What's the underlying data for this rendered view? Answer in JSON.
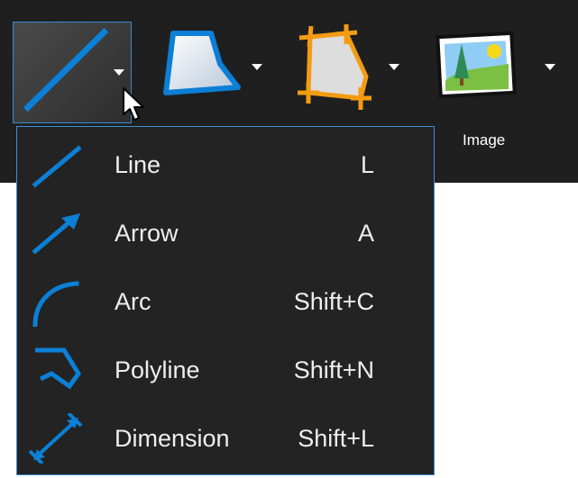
{
  "toolbar": {
    "tools": [
      {
        "name": "line-tool",
        "icon": "line-icon",
        "dropdown": true
      },
      {
        "name": "polygon-tool",
        "icon": "polygon-icon",
        "dropdown": true
      },
      {
        "name": "crop-tool",
        "icon": "crop-icon",
        "dropdown": true
      },
      {
        "name": "image-tool",
        "icon": "image-icon",
        "dropdown": true,
        "label": "Image"
      }
    ]
  },
  "menu": {
    "items": [
      {
        "label": "Line",
        "shortcut": "L",
        "icon": "line-icon"
      },
      {
        "label": "Arrow",
        "shortcut": "A",
        "icon": "arrow-icon"
      },
      {
        "label": "Arc",
        "shortcut": "Shift+C",
        "icon": "arc-icon"
      },
      {
        "label": "Polyline",
        "shortcut": "Shift+N",
        "icon": "polyline-icon"
      },
      {
        "label": "Dimension",
        "shortcut": "Shift+L",
        "icon": "dimension-icon"
      }
    ]
  },
  "colors": {
    "toolbar_background": "#1f1f1f",
    "menu_background": "#232323",
    "accent_blue": "#0c7fd6",
    "menu_border": "#3f8ed6",
    "crop_orange": "#f39c12",
    "text": "#eeeeee"
  }
}
